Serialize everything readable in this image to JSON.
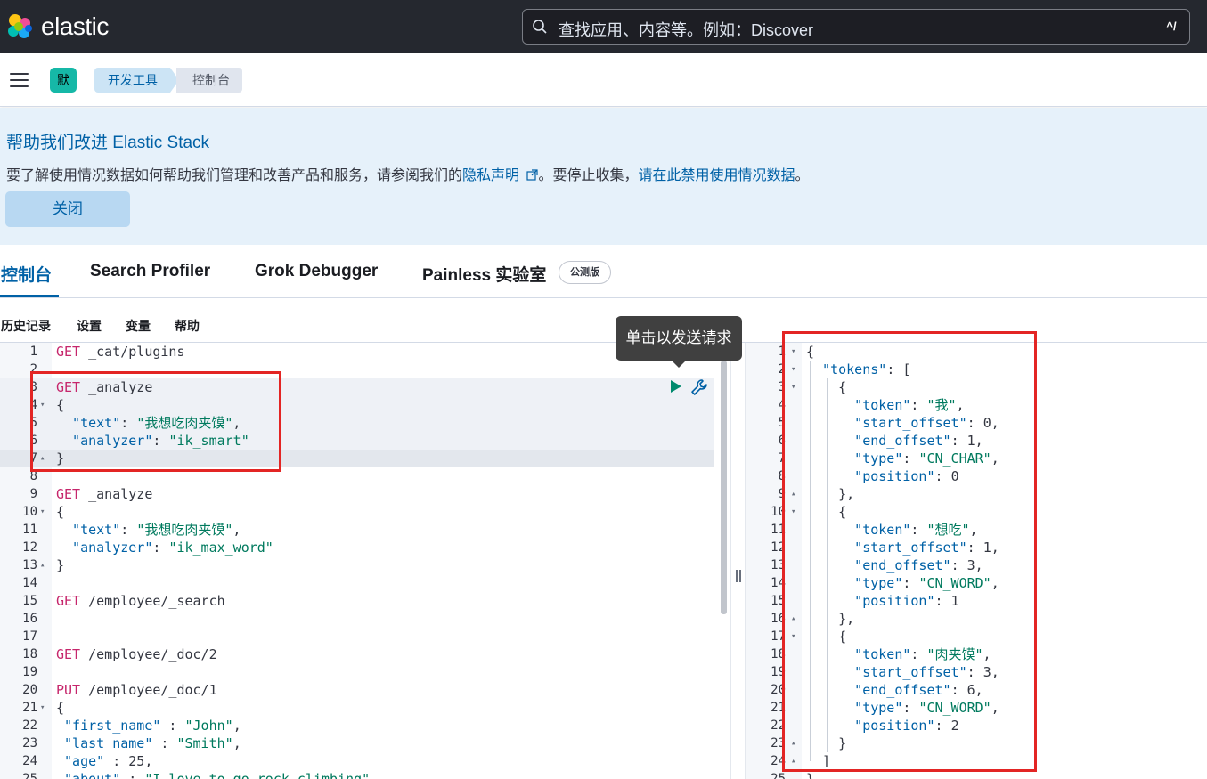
{
  "header": {
    "brand": "elastic",
    "search_placeholder": "查找应用、内容等。例如：Discover",
    "search_shortcut": "^/"
  },
  "subheader": {
    "space_avatar": "默",
    "breadcrumbs": [
      "开发工具",
      "控制台"
    ]
  },
  "callout": {
    "title": "帮助我们改进 Elastic Stack",
    "text_before": "要了解使用情况数据如何帮助我们管理和改善产品和服务，请参阅我们的",
    "privacy_link": "隐私声明",
    "text_middle": "。要停止收集，",
    "disable_link": "请在此禁用使用情况数据",
    "text_after": "。",
    "close_label": "关闭"
  },
  "tabs": [
    "控制台",
    "Search Profiler",
    "Grok Debugger",
    "Painless 实验室"
  ],
  "beta_badge": "公测版",
  "toolbar": [
    "历史记录",
    "设置",
    "变量",
    "帮助"
  ],
  "tooltip": "单击以发送请求",
  "request_editor": {
    "lines": [
      {
        "n": "1",
        "fold": "",
        "tokens": [
          [
            "kw",
            "GET"
          ],
          [
            "path",
            " _cat/plugins"
          ]
        ]
      },
      {
        "n": "2",
        "fold": "",
        "tokens": []
      },
      {
        "n": "3",
        "fold": "",
        "tokens": [
          [
            "kw",
            "GET"
          ],
          [
            "path",
            " _analyze"
          ]
        ]
      },
      {
        "n": "4",
        "fold": "▾",
        "tokens": [
          [
            "path",
            "{"
          ]
        ]
      },
      {
        "n": "5",
        "fold": "",
        "tokens": [
          [
            "key",
            "  \"text\""
          ],
          [
            "path",
            ": "
          ],
          [
            "str",
            "\"我想吃肉夹馍\""
          ],
          [
            "path",
            ","
          ]
        ]
      },
      {
        "n": "6",
        "fold": "",
        "tokens": [
          [
            "key",
            "  \"analyzer\""
          ],
          [
            "path",
            ": "
          ],
          [
            "str",
            "\"ik_smart\""
          ]
        ]
      },
      {
        "n": "7",
        "fold": "▴",
        "tokens": [
          [
            "path",
            "}"
          ]
        ]
      },
      {
        "n": "8",
        "fold": "",
        "tokens": []
      },
      {
        "n": "9",
        "fold": "",
        "tokens": [
          [
            "kw",
            "GET"
          ],
          [
            "path",
            " _analyze"
          ]
        ]
      },
      {
        "n": "10",
        "fold": "▾",
        "tokens": [
          [
            "path",
            "{"
          ]
        ]
      },
      {
        "n": "11",
        "fold": "",
        "tokens": [
          [
            "key",
            "  \"text\""
          ],
          [
            "path",
            ": "
          ],
          [
            "str",
            "\"我想吃肉夹馍\""
          ],
          [
            "path",
            ","
          ]
        ]
      },
      {
        "n": "12",
        "fold": "",
        "tokens": [
          [
            "key",
            "  \"analyzer\""
          ],
          [
            "path",
            ": "
          ],
          [
            "str",
            "\"ik_max_word\""
          ]
        ]
      },
      {
        "n": "13",
        "fold": "▴",
        "tokens": [
          [
            "path",
            "}"
          ]
        ]
      },
      {
        "n": "14",
        "fold": "",
        "tokens": []
      },
      {
        "n": "15",
        "fold": "",
        "tokens": [
          [
            "kw",
            "GET"
          ],
          [
            "path",
            " /employee/_search"
          ]
        ]
      },
      {
        "n": "16",
        "fold": "",
        "tokens": []
      },
      {
        "n": "17",
        "fold": "",
        "tokens": []
      },
      {
        "n": "18",
        "fold": "",
        "tokens": [
          [
            "kw",
            "GET"
          ],
          [
            "path",
            " /employee/_doc/2"
          ]
        ]
      },
      {
        "n": "19",
        "fold": "",
        "tokens": []
      },
      {
        "n": "20",
        "fold": "",
        "tokens": [
          [
            "kw",
            "PUT"
          ],
          [
            "path",
            " /employee/_doc/1"
          ]
        ]
      },
      {
        "n": "21",
        "fold": "▾",
        "tokens": [
          [
            "path",
            "{"
          ]
        ]
      },
      {
        "n": "22",
        "fold": "",
        "tokens": [
          [
            "key",
            " \"first_name\""
          ],
          [
            "path",
            " : "
          ],
          [
            "str",
            "\"John\""
          ],
          [
            "path",
            ","
          ]
        ]
      },
      {
        "n": "23",
        "fold": "",
        "tokens": [
          [
            "key",
            " \"last_name\""
          ],
          [
            "path",
            " : "
          ],
          [
            "str",
            "\"Smith\""
          ],
          [
            "path",
            ","
          ]
        ]
      },
      {
        "n": "24",
        "fold": "",
        "tokens": [
          [
            "key",
            " \"age\""
          ],
          [
            "path",
            " : "
          ],
          [
            "num",
            "25"
          ],
          [
            "path",
            ","
          ]
        ]
      },
      {
        "n": "25",
        "fold": "",
        "tokens": [
          [
            "key",
            " \"about\""
          ],
          [
            "path",
            " : "
          ],
          [
            "str",
            "\"I love to go rock climbing\""
          ],
          [
            "path",
            ","
          ]
        ]
      }
    ]
  },
  "response_editor": {
    "lines": [
      {
        "n": "1",
        "fold": "▾",
        "tokens": [
          [
            "path",
            "{"
          ]
        ]
      },
      {
        "n": "2",
        "fold": "▾",
        "tokens": [
          [
            "key",
            "  \"tokens\""
          ],
          [
            "path",
            ": ["
          ]
        ]
      },
      {
        "n": "3",
        "fold": "▾",
        "tokens": [
          [
            "path",
            "    {"
          ]
        ]
      },
      {
        "n": "4",
        "fold": "",
        "tokens": [
          [
            "key",
            "      \"token\""
          ],
          [
            "path",
            ": "
          ],
          [
            "str",
            "\"我\""
          ],
          [
            "path",
            ","
          ]
        ]
      },
      {
        "n": "5",
        "fold": "",
        "tokens": [
          [
            "key",
            "      \"start_offset\""
          ],
          [
            "path",
            ": "
          ],
          [
            "num",
            "0"
          ],
          [
            "path",
            ","
          ]
        ]
      },
      {
        "n": "6",
        "fold": "",
        "tokens": [
          [
            "key",
            "      \"end_offset\""
          ],
          [
            "path",
            ": "
          ],
          [
            "num",
            "1"
          ],
          [
            "path",
            ","
          ]
        ]
      },
      {
        "n": "7",
        "fold": "",
        "tokens": [
          [
            "key",
            "      \"type\""
          ],
          [
            "path",
            ": "
          ],
          [
            "str",
            "\"CN_CHAR\""
          ],
          [
            "path",
            ","
          ]
        ]
      },
      {
        "n": "8",
        "fold": "",
        "tokens": [
          [
            "key",
            "      \"position\""
          ],
          [
            "path",
            ": "
          ],
          [
            "num",
            "0"
          ]
        ]
      },
      {
        "n": "9",
        "fold": "▴",
        "tokens": [
          [
            "path",
            "    },"
          ]
        ]
      },
      {
        "n": "10",
        "fold": "▾",
        "tokens": [
          [
            "path",
            "    {"
          ]
        ]
      },
      {
        "n": "11",
        "fold": "",
        "tokens": [
          [
            "key",
            "      \"token\""
          ],
          [
            "path",
            ": "
          ],
          [
            "str",
            "\"想吃\""
          ],
          [
            "path",
            ","
          ]
        ]
      },
      {
        "n": "12",
        "fold": "",
        "tokens": [
          [
            "key",
            "      \"start_offset\""
          ],
          [
            "path",
            ": "
          ],
          [
            "num",
            "1"
          ],
          [
            "path",
            ","
          ]
        ]
      },
      {
        "n": "13",
        "fold": "",
        "tokens": [
          [
            "key",
            "      \"end_offset\""
          ],
          [
            "path",
            ": "
          ],
          [
            "num",
            "3"
          ],
          [
            "path",
            ","
          ]
        ]
      },
      {
        "n": "14",
        "fold": "",
        "tokens": [
          [
            "key",
            "      \"type\""
          ],
          [
            "path",
            ": "
          ],
          [
            "str",
            "\"CN_WORD\""
          ],
          [
            "path",
            ","
          ]
        ]
      },
      {
        "n": "15",
        "fold": "",
        "tokens": [
          [
            "key",
            "      \"position\""
          ],
          [
            "path",
            ": "
          ],
          [
            "num",
            "1"
          ]
        ]
      },
      {
        "n": "16",
        "fold": "▴",
        "tokens": [
          [
            "path",
            "    },"
          ]
        ]
      },
      {
        "n": "17",
        "fold": "▾",
        "tokens": [
          [
            "path",
            "    {"
          ]
        ]
      },
      {
        "n": "18",
        "fold": "",
        "tokens": [
          [
            "key",
            "      \"token\""
          ],
          [
            "path",
            ": "
          ],
          [
            "str",
            "\"肉夹馍\""
          ],
          [
            "path",
            ","
          ]
        ]
      },
      {
        "n": "19",
        "fold": "",
        "tokens": [
          [
            "key",
            "      \"start_offset\""
          ],
          [
            "path",
            ": "
          ],
          [
            "num",
            "3"
          ],
          [
            "path",
            ","
          ]
        ]
      },
      {
        "n": "20",
        "fold": "",
        "tokens": [
          [
            "key",
            "      \"end_offset\""
          ],
          [
            "path",
            ": "
          ],
          [
            "num",
            "6"
          ],
          [
            "path",
            ","
          ]
        ]
      },
      {
        "n": "21",
        "fold": "",
        "tokens": [
          [
            "key",
            "      \"type\""
          ],
          [
            "path",
            ": "
          ],
          [
            "str",
            "\"CN_WORD\""
          ],
          [
            "path",
            ","
          ]
        ]
      },
      {
        "n": "22",
        "fold": "",
        "tokens": [
          [
            "key",
            "      \"position\""
          ],
          [
            "path",
            ": "
          ],
          [
            "num",
            "2"
          ]
        ]
      },
      {
        "n": "23",
        "fold": "▴",
        "tokens": [
          [
            "path",
            "    }"
          ]
        ]
      },
      {
        "n": "24",
        "fold": "▴",
        "tokens": [
          [
            "path",
            "  ]"
          ]
        ]
      },
      {
        "n": "25",
        "fold": "",
        "tokens": [
          [
            "path",
            "}"
          ]
        ]
      }
    ]
  },
  "colors": {
    "header_bg": "#25282f",
    "accent": "#0061a6",
    "highlight_box": "#e32524",
    "run_button": "#008a6e"
  }
}
